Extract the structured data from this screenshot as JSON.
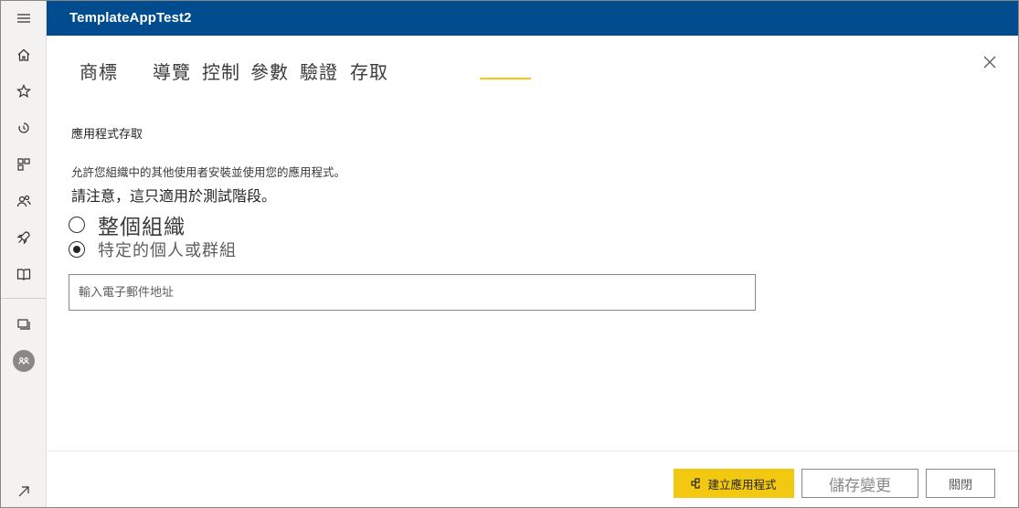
{
  "header": {
    "app_title": "TemplateAppTest2"
  },
  "rail": {
    "icons": [
      "hamburger-menu-icon",
      "home-icon",
      "star-icon",
      "recent-icon",
      "apps-icon",
      "shared-icon",
      "deployment-icon",
      "learn-book-icon",
      "workspaces-icon",
      "workspace-avatar-icon",
      "expand-icon"
    ]
  },
  "tabs": [
    {
      "label": "商標"
    },
    {
      "label": "導覽"
    },
    {
      "label": "控制"
    },
    {
      "label": "參數"
    },
    {
      "label": "驗證"
    },
    {
      "label": "存取"
    }
  ],
  "accent_color": "#f2c811",
  "header_color": "#004c8f",
  "access": {
    "title": "應用程式存取",
    "description": "允許您組織中的其他使用者安裝並使用您的應用程式。",
    "note": "請注意，這只適用於測試階段。",
    "options": [
      {
        "label": "整個組織",
        "selected": false
      },
      {
        "label": "特定的個人或群組",
        "selected": true
      }
    ],
    "email_placeholder": "輸入電子郵件地址",
    "email_value": ""
  },
  "footer": {
    "create_app_label": "建立應用程式",
    "save_label": "儲存變更",
    "close_label": "關閉"
  }
}
